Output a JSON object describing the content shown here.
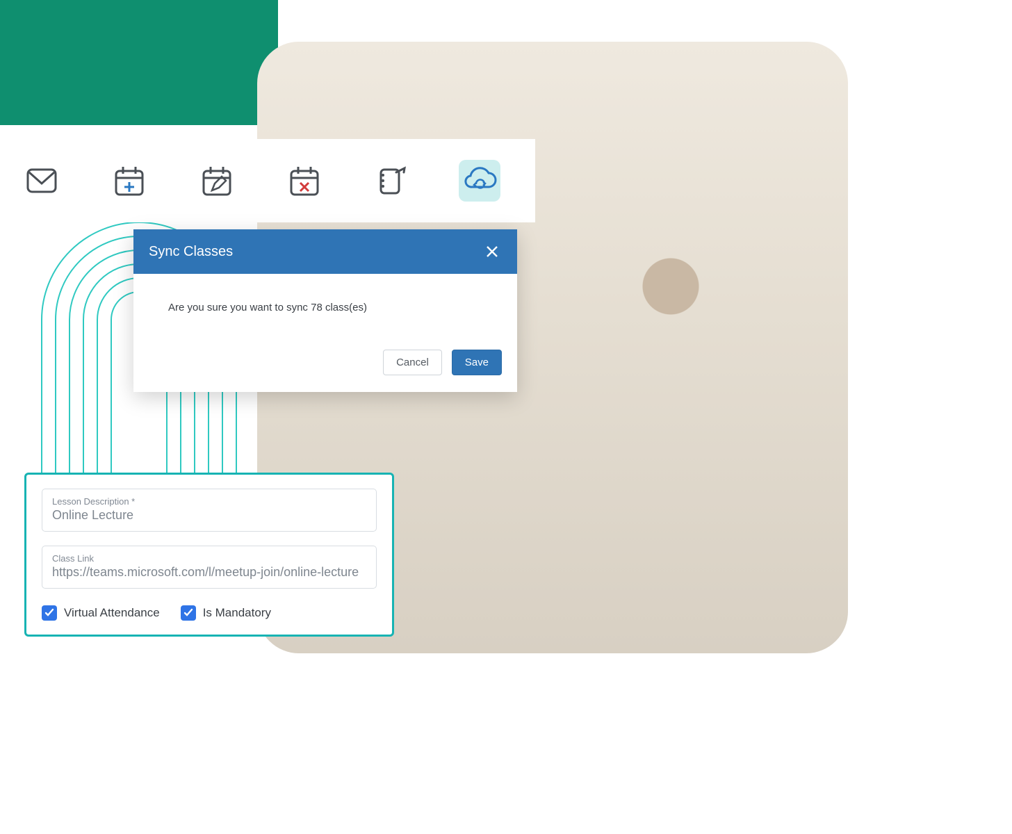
{
  "colors": {
    "primary_blue": "#2f74b5",
    "teal_accent": "#17b3b3",
    "green_bg": "#0f8f6f",
    "active_icon_bg": "#cdeeee"
  },
  "toolbar": {
    "icons": [
      {
        "name": "mail-icon"
      },
      {
        "name": "calendar-add-icon"
      },
      {
        "name": "calendar-edit-icon"
      },
      {
        "name": "calendar-delete-icon"
      },
      {
        "name": "share-link-icon"
      },
      {
        "name": "cloud-sync-icon",
        "active": true
      }
    ]
  },
  "dialog": {
    "title": "Sync Classes",
    "message": "Are you sure you want to sync 78 class(es)",
    "cancel_label": "Cancel",
    "save_label": "Save"
  },
  "form": {
    "lesson_description": {
      "label": "Lesson Description *",
      "value": "Online Lecture"
    },
    "class_link": {
      "label": "Class Link",
      "value": "https://teams.microsoft.com/l/meetup-join/online-lecture"
    },
    "virtual_attendance": {
      "label": "Virtual Attendance",
      "checked": true
    },
    "is_mandatory": {
      "label": "Is Mandatory",
      "checked": true
    }
  }
}
